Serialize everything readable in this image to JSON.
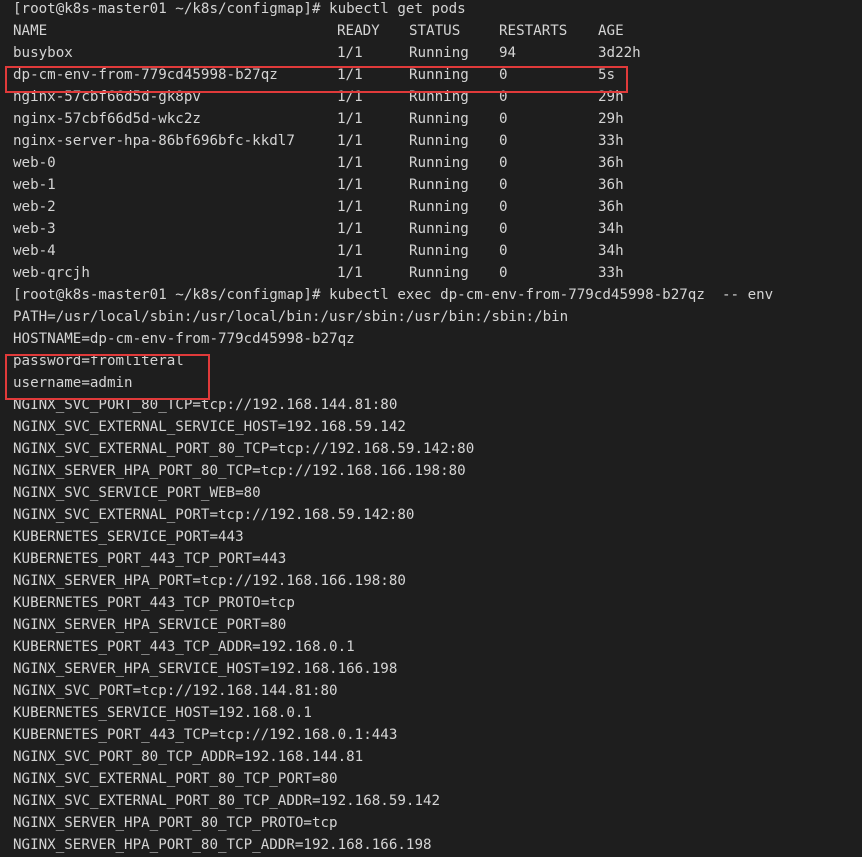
{
  "terminal": {
    "prompt1": "[root@k8s-master01 ~/k8s/configmap]# kubectl get pods",
    "table": {
      "headers": [
        "NAME",
        "READY",
        "STATUS",
        "RESTARTS",
        "AGE"
      ],
      "rows": [
        [
          "busybox",
          "1/1",
          "Running",
          "94",
          "3d22h"
        ],
        [
          "dp-cm-env-from-779cd45998-b27qz",
          "1/1",
          "Running",
          "0",
          "5s"
        ],
        [
          "nginx-57cbf66d5d-gk8pv",
          "1/1",
          "Running",
          "0",
          "29h"
        ],
        [
          "nginx-57cbf66d5d-wkc2z",
          "1/1",
          "Running",
          "0",
          "29h"
        ],
        [
          "nginx-server-hpa-86bf696bfc-kkdl7",
          "1/1",
          "Running",
          "0",
          "33h"
        ],
        [
          "web-0",
          "1/1",
          "Running",
          "0",
          "36h"
        ],
        [
          "web-1",
          "1/1",
          "Running",
          "0",
          "36h"
        ],
        [
          "web-2",
          "1/1",
          "Running",
          "0",
          "36h"
        ],
        [
          "web-3",
          "1/1",
          "Running",
          "0",
          "34h"
        ],
        [
          "web-4",
          "1/1",
          "Running",
          "0",
          "34h"
        ],
        [
          "web-qrcjh",
          "1/1",
          "Running",
          "0",
          "33h"
        ]
      ]
    },
    "prompt2": "[root@k8s-master01 ~/k8s/configmap]# kubectl exec dp-cm-env-from-779cd45998-b27qz  -- env",
    "env_lines": [
      "PATH=/usr/local/sbin:/usr/local/bin:/usr/sbin:/usr/bin:/sbin:/bin",
      "HOSTNAME=dp-cm-env-from-779cd45998-b27qz",
      "password=fromliteral",
      "username=admin",
      "NGINX_SVC_PORT_80_TCP=tcp://192.168.144.81:80",
      "NGINX_SVC_EXTERNAL_SERVICE_HOST=192.168.59.142",
      "NGINX_SVC_EXTERNAL_PORT_80_TCP=tcp://192.168.59.142:80",
      "NGINX_SERVER_HPA_PORT_80_TCP=tcp://192.168.166.198:80",
      "NGINX_SVC_SERVICE_PORT_WEB=80",
      "NGINX_SVC_EXTERNAL_PORT=tcp://192.168.59.142:80",
      "KUBERNETES_SERVICE_PORT=443",
      "KUBERNETES_PORT_443_TCP_PORT=443",
      "NGINX_SERVER_HPA_PORT=tcp://192.168.166.198:80",
      "KUBERNETES_PORT_443_TCP_PROTO=tcp",
      "NGINX_SERVER_HPA_SERVICE_PORT=80",
      "KUBERNETES_PORT_443_TCP_ADDR=192.168.0.1",
      "NGINX_SERVER_HPA_SERVICE_HOST=192.168.166.198",
      "NGINX_SVC_PORT=tcp://192.168.144.81:80",
      "KUBERNETES_SERVICE_HOST=192.168.0.1",
      "KUBERNETES_PORT_443_TCP=tcp://192.168.0.1:443",
      "NGINX_SVC_PORT_80_TCP_ADDR=192.168.144.81",
      "NGINX_SVC_EXTERNAL_PORT_80_TCP_PORT=80",
      "NGINX_SVC_EXTERNAL_PORT_80_TCP_ADDR=192.168.59.142",
      "NGINX_SERVER_HPA_PORT_80_TCP_PROTO=tcp",
      "NGINX_SERVER_HPA_PORT_80_TCP_ADDR=192.168.166.198"
    ]
  },
  "colors": {
    "background": "#1e1e1e",
    "text": "#d4d4d4",
    "highlight": "#e03a3a"
  }
}
